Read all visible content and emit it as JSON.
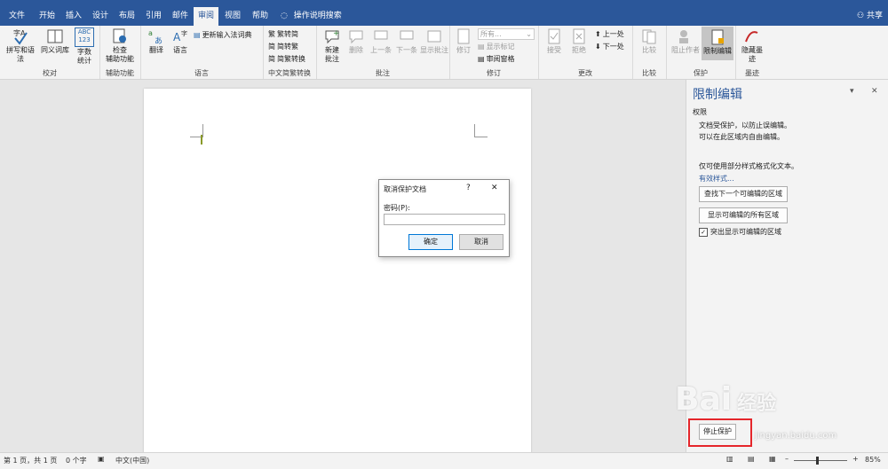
{
  "tabs": [
    "文件",
    "开始",
    "插入",
    "设计",
    "布局",
    "引用",
    "邮件",
    "审阅",
    "视图",
    "帮助"
  ],
  "tell_me": "操作说明搜索",
  "share_label": "共享",
  "ribbon": {
    "proofing": {
      "label": "校对",
      "spelling": "拼写和语法",
      "thesaurus": "同义词库",
      "wordcount": "字数\n统计",
      "abc_icon_text": "ABC\n123"
    },
    "accessibility": {
      "label": "辅助功能",
      "check": "检查\n辅助功能"
    },
    "language": {
      "label": "语言",
      "translate": "翻译",
      "language": "语言",
      "update_ime": "更新输入法词典"
    },
    "chinese": {
      "label": "中文简繁转换",
      "to_traditional": "繁转简",
      "to_simplified": "简转繁",
      "convert": "简繁转换"
    },
    "comments": {
      "label": "批注",
      "new": "新建\n批注",
      "delete": "删除",
      "prev": "上一条",
      "next": "下一条",
      "show": "显示批注"
    },
    "tracking": {
      "label": "修订",
      "track": "修订",
      "markup_select": "所有...",
      "show_markup": "显示标记",
      "review_pane": "审阅窗格"
    },
    "changes": {
      "label": "更改",
      "accept": "接受",
      "reject": "拒绝",
      "prev": "上一处",
      "next": "下一处"
    },
    "compare": {
      "label": "比较",
      "compare": "比较"
    },
    "protect": {
      "label": "保护",
      "block_authors": "阻止作者",
      "restrict": "限制编辑"
    },
    "ink": {
      "label": "墨迹",
      "hide_ink": "隐藏墨\n迹"
    }
  },
  "dialog": {
    "title": "取消保护文档",
    "help": "?",
    "close": "✕",
    "password_label": "密码(P):",
    "password_value": "",
    "ok": "确定",
    "cancel": "取消"
  },
  "pane": {
    "title": "限制编辑",
    "section": "权限",
    "desc_line1": "文档受保护，以防止误编辑。",
    "desc_line2": "可以在此区域内自由编辑。",
    "styles_note": "仅可使用部分样式格式化文本。",
    "styles_link": "有效样式...",
    "find_next": "查找下一个可编辑的区域",
    "show_all": "显示可编辑的所有区域",
    "highlight_label": "突出显示可编辑的区域",
    "highlight_checked": "✓",
    "stop_button": "停止保护",
    "dropdown": "▾",
    "close": "✕"
  },
  "status": {
    "pages": "第 1 页，共 1 页",
    "words": "0 个字",
    "language": "中文(中国)",
    "zoom": "85%",
    "minus": "–",
    "plus": "+"
  },
  "watermark": {
    "main": "Bai",
    "suffix": "经验",
    "url": "jingyan.baidu.com"
  },
  "colors": {
    "accent": "#2b579a",
    "stop_highlight": "#e5262b"
  }
}
